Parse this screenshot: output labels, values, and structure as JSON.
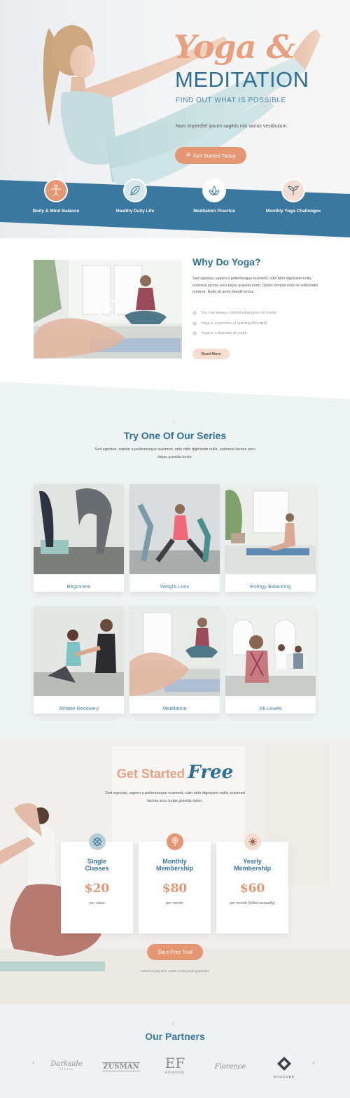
{
  "hero": {
    "script_title": "Yoga &",
    "title": "MEDITATION",
    "subtitle": "FIND OUT WHAT IS POSSIBLE",
    "body": "Nam imperdiet ipsum sagittis nisi varius vestibulum.",
    "cta_label": "Get Started Today",
    "features": [
      {
        "label": "Body & Mind Balance",
        "icon": "person-balance-icon"
      },
      {
        "label": "Healthy Daily Life",
        "icon": "leaf-icon"
      },
      {
        "label": "Meditation Practice",
        "icon": "lotus-icon"
      },
      {
        "label": "Monthly Yoga Challenges",
        "icon": "sprout-icon"
      }
    ]
  },
  "why": {
    "title": "Why Do Yoga?",
    "body": "Sed egestas, sapien a pellentesque euismod, odio nibh dignissim nulla, euismod lacinia arcu turpis gravida tortor. Donec tempor enim ut sollicitudin pulvinar. Nulla sit amet blandit lectus.",
    "points": [
      "You can always control what goes on inside",
      "Yoga is a practice of quieting the mind",
      "Yoga is a fountain of youth"
    ],
    "button": "Read More"
  },
  "series": {
    "title": "Try One Of Our Series",
    "body": "Sed egestas, sapien a pellentesque euismod, odio nibh dignissim nulla, euismod lacinia arcu turpis gravida tortor.",
    "cards": [
      "Beginners",
      "Weight Loss",
      "Energy Balancing",
      "Athlete Recovery",
      "Meditation",
      "All Levels"
    ]
  },
  "get_started": {
    "title_a": "Get Started",
    "title_b": "Free",
    "body": "Sed egestas, sapien a pellentesque euismod, odio nibh dignissim nulla, euismod lacinia arcu turpis gravida tortor.",
    "plans": [
      {
        "title_1": "Single",
        "title_2": "Classes",
        "price": "$20",
        "period": "per class",
        "icon": "lattice-icon",
        "icon_color": "#b9cfd8"
      },
      {
        "title_1": "Monthly",
        "title_2": "Membership",
        "price": "$80",
        "period": "per month",
        "icon": "tree-icon",
        "icon_color": "#e59673"
      },
      {
        "title_1": "Yearly",
        "title_2": "Membership",
        "price": "$60",
        "period": "per month (billed annually)",
        "icon": "mandala-icon",
        "icon_color": "#f3ddd2"
      }
    ],
    "cta_label": "Start Free Trial",
    "fine_print": "Cancel at any time. 100% money back guarantee"
  },
  "partners": {
    "title": "Our Partners",
    "logos": [
      {
        "name": "Darkside",
        "sub": "STUDIO"
      },
      {
        "name": "ZUSMAN",
        "sub": ""
      },
      {
        "name": "ARMOND",
        "sub": ""
      },
      {
        "name": "Florence",
        "sub": ""
      },
      {
        "name": "ECOCODE",
        "sub": ""
      }
    ]
  },
  "colors": {
    "primary": "#2f6f95",
    "accent": "#e59673",
    "band": "#3a78a0"
  }
}
